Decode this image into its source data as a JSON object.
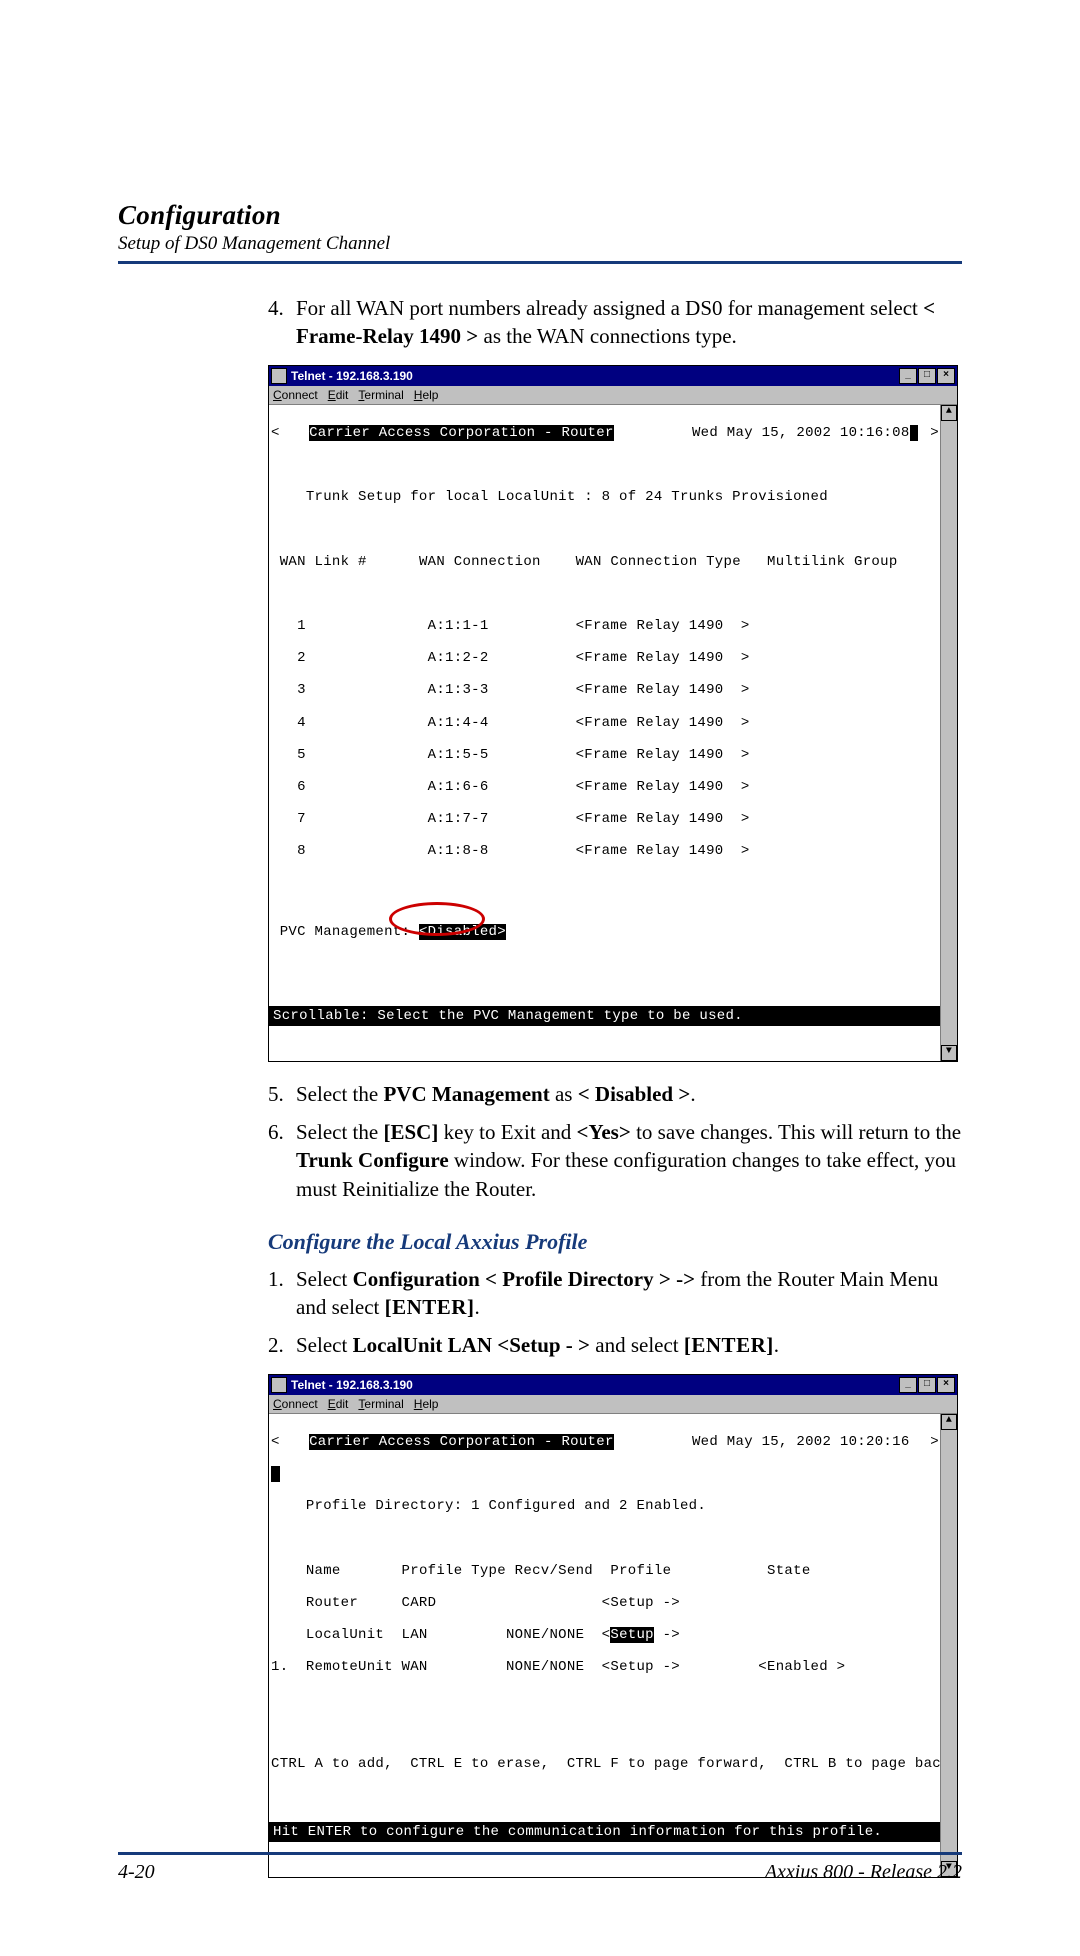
{
  "header": {
    "title": "Configuration",
    "subtitle": "Setup of DS0 Management Channel"
  },
  "step4": {
    "num": "4.",
    "pre": "For all WAN port numbers already assigned a DS0 for management select ",
    "bold": "< Frame-Relay 1490 >",
    "post": " as the WAN connections type."
  },
  "telnet1": {
    "title": "Telnet - 192.168.3.190",
    "menu": {
      "connect": "Connect",
      "edit": "Edit",
      "terminal": "Terminal",
      "help": "Help"
    },
    "banner": "Carrier Access Corporation - Router",
    "datetime": "Wed May 15, 2002 10:16:08",
    "trunk_line": "Trunk Setup for local LocalUnit : 8 of 24 Trunks Provisioned",
    "cols": {
      "c1": "WAN Link #",
      "c2": "WAN Connection",
      "c3": "WAN Connection Type",
      "c4": "Multilink Group"
    },
    "rows": [
      {
        "n": "1",
        "conn": "A:1:1-1",
        "type": "<Frame Relay 1490  >"
      },
      {
        "n": "2",
        "conn": "A:1:2-2",
        "type": "<Frame Relay 1490  >"
      },
      {
        "n": "3",
        "conn": "A:1:3-3",
        "type": "<Frame Relay 1490  >"
      },
      {
        "n": "4",
        "conn": "A:1:4-4",
        "type": "<Frame Relay 1490  >"
      },
      {
        "n": "5",
        "conn": "A:1:5-5",
        "type": "<Frame Relay 1490  >"
      },
      {
        "n": "6",
        "conn": "A:1:6-6",
        "type": "<Frame Relay 1490  >"
      },
      {
        "n": "7",
        "conn": "A:1:7-7",
        "type": "<Frame Relay 1490  >"
      },
      {
        "n": "8",
        "conn": "A:1:8-8",
        "type": "<Frame Relay 1490  >"
      }
    ],
    "pvc_label": "PVC Management: ",
    "pvc_value": "<Disabled>",
    "footer": "Scrollable: Select the PVC Management type to be used."
  },
  "step5": {
    "num": "5.",
    "t1": "Select the ",
    "b1": "PVC Management",
    "t2": " as ",
    "b2": "< Disabled >",
    "t3": "."
  },
  "step6": {
    "num": "6.",
    "t1": "Select the ",
    "b1": "[ESC]",
    "t2": " key to Exit and ",
    "b2": "<Yes>",
    "t3": " to save changes. This will return to the ",
    "b3": "Trunk Configure",
    "t4": " window. For these configuration changes to take effect, you must Reinitialize the Router."
  },
  "section2": {
    "heading": "Configure the Local Axxius Profile"
  },
  "s2step1": {
    "num": "1.",
    "t1": "Select ",
    "b1": "Configuration < Profile Directory >  ->",
    "t2": " from the Router Main Menu and select ",
    "b2": "[ENTER]",
    "t3": "."
  },
  "s2step2": {
    "num": "2.",
    "t1": "Select ",
    "b1": "LocalUnit LAN  <Setup - >",
    "t2": " and select ",
    "b2": "[ENTER]",
    "t3": "."
  },
  "telnet2": {
    "title": "Telnet - 192.168.3.190",
    "menu": {
      "connect": "Connect",
      "edit": "Edit",
      "terminal": "Terminal",
      "help": "Help"
    },
    "banner": "Carrier Access Corporation - Router",
    "datetime": "Wed May 15, 2002 10:20:16",
    "profile_line": "Profile Directory: 1 Configured and 2 Enabled.",
    "cols": {
      "name": "Name",
      "ptype": "Profile Type",
      "rs": "Recv/Send",
      "profile": "Profile",
      "state": "State"
    },
    "rows": [
      {
        "idx": "   ",
        "name": "Router    ",
        "ptype": "CARD        ",
        "rs": "         ",
        "profile_pre": "<Setup ->",
        "profile_sel": "",
        "state": ""
      },
      {
        "idx": "   ",
        "name": "LocalUnit ",
        "ptype": "LAN         ",
        "rs": "NONE/NONE",
        "profile_pre": "<",
        "profile_sel": "Setup",
        "profile_post": " ->",
        "state": ""
      },
      {
        "idx": "1. ",
        "name": "RemoteUnit",
        "ptype": "WAN         ",
        "rs": "NONE/NONE",
        "profile_pre": "<Setup ->",
        "profile_sel": "",
        "state": "<Enabled >"
      }
    ],
    "hint": "CTRL A to add,  CTRL E to erase,  CTRL F to page forward,  CTRL B to page back",
    "footer": "Hit ENTER to configure the communication information for this profile."
  },
  "footer": {
    "left": "4-20",
    "right": "Axxius 800 - Release 2.2"
  },
  "winbtns": {
    "min": "_",
    "max": "□",
    "close": "×"
  },
  "scroll": {
    "up": "▲",
    "down": "▼"
  }
}
